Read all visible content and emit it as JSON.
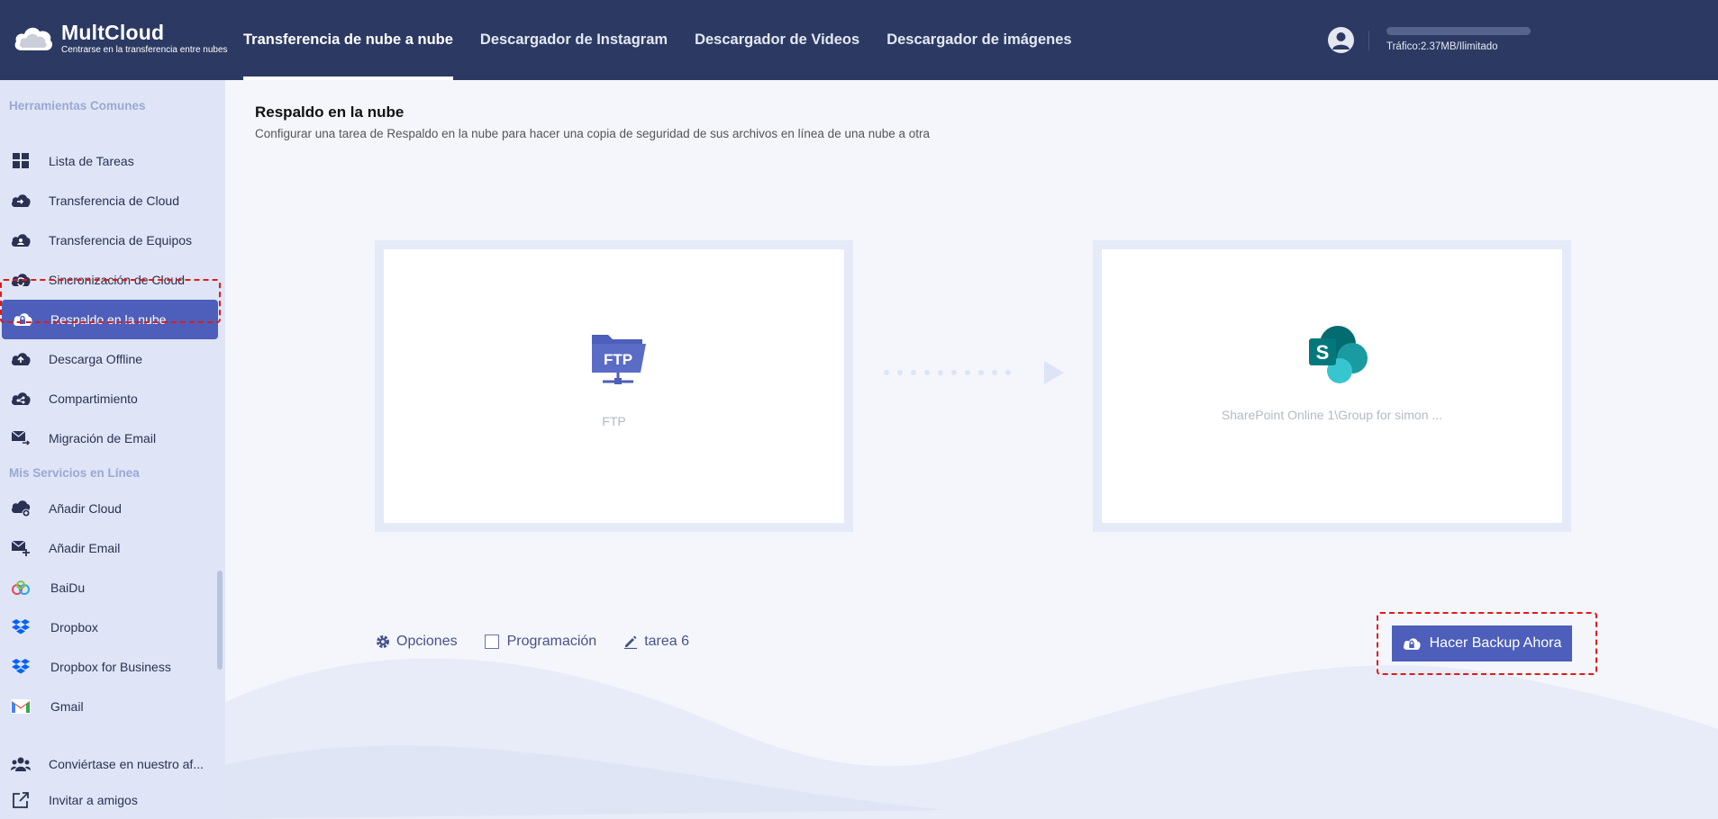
{
  "header": {
    "logo_title": "MultCloud",
    "logo_subtitle": "Centrarse en la transferencia entre nubes",
    "nav": [
      {
        "label": "Transferencia de nube a nube",
        "active": true
      },
      {
        "label": "Descargador de Instagram",
        "active": false
      },
      {
        "label": "Descargador de Videos",
        "active": false
      },
      {
        "label": "Descargador de imágenes",
        "active": false
      }
    ],
    "traffic": "Tráfico:2.37MB/Ilimitado"
  },
  "sidebar": {
    "section_tools": "Herramientas Comunes",
    "tools": [
      {
        "label": "Lista de Tareas",
        "icon": "grid-icon"
      },
      {
        "label": "Transferencia de Cloud",
        "icon": "cloud-transfer-icon"
      },
      {
        "label": "Transferencia de Equipos",
        "icon": "team-transfer-icon"
      },
      {
        "label": "Sincronización de Cloud",
        "icon": "cloud-sync-icon"
      },
      {
        "label": "Respaldo en la nube",
        "icon": "cloud-backup-icon",
        "active": true
      },
      {
        "label": "Descarga Offline",
        "icon": "offline-download-icon"
      },
      {
        "label": "Compartimiento",
        "icon": "share-icon"
      },
      {
        "label": "Migración de Email",
        "icon": "email-migration-icon"
      }
    ],
    "section_services": "Mis Servicios en Línea",
    "services": [
      {
        "label": "Añadir Cloud",
        "icon": "add-cloud-icon"
      },
      {
        "label": "Añadir Email",
        "icon": "add-email-icon"
      },
      {
        "label": "BaiDu",
        "icon": "baidu-icon"
      },
      {
        "label": "Dropbox",
        "icon": "dropbox-icon"
      },
      {
        "label": "Dropbox for Business",
        "icon": "dropbox-business-icon"
      },
      {
        "label": "Gmail",
        "icon": "gmail-icon"
      }
    ],
    "bottom": [
      {
        "label": "Conviértase en nuestro af...",
        "icon": "affiliate-icon"
      },
      {
        "label": "Invitar a amigos",
        "icon": "invite-icon"
      }
    ]
  },
  "main": {
    "title": "Respaldo en la nube",
    "description": "Configurar una tarea de Respaldo en la nube para hacer una copia de seguridad de sus archivos en línea de una nube a otra",
    "source": {
      "label": "FTP",
      "icon": "ftp-icon"
    },
    "target": {
      "label": "SharePoint Online 1\\Group for simon ...",
      "icon": "sharepoint-icon"
    },
    "options_label": "Opciones",
    "schedule_label": "Programación",
    "task_name": "tarea 6",
    "backup_button": "Hacer Backup Ahora"
  },
  "colors": {
    "header_bg": "#2c3a63",
    "sidebar_bg": "#dfe5f6",
    "accent": "#4d5fba",
    "highlight": "#e01b1b"
  }
}
